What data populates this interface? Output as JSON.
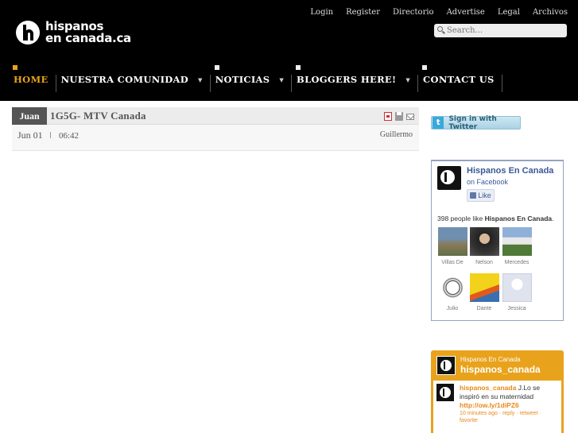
{
  "site": {
    "logo_line1": "hispanos",
    "logo_line2": "en canada.ca"
  },
  "top_links": [
    "Login",
    "Register",
    "Directorio",
    "Advertise",
    "Legal",
    "Archivos"
  ],
  "search": {
    "placeholder": "Search..."
  },
  "nav": [
    {
      "label": "HOME",
      "active": true,
      "dropdown": false
    },
    {
      "label": "NUESTRA COMUNIDAD",
      "active": false,
      "dropdown": true
    },
    {
      "label": "NOTICIAS",
      "active": false,
      "dropdown": true
    },
    {
      "label": "BLOGGERS HERE!",
      "active": false,
      "dropdown": true
    },
    {
      "label": "CONTACT US",
      "active": false,
      "dropdown": false
    }
  ],
  "article": {
    "month_tab": "Juan",
    "title": "1G5G- MTV Canada",
    "date": "Jun 01",
    "time": "06:42",
    "author": "Guillermo"
  },
  "twitter_button": {
    "label": "Sign in with Twitter"
  },
  "facebook": {
    "page_name": "Hispanos En Canada",
    "subtitle": "on Facebook",
    "like_label": "Like",
    "count_text": "398 people like",
    "count_page": "Hispanos En Canada",
    "fans": [
      "Villas De",
      "Nelson",
      "Mercedes",
      "Julio",
      "Dante",
      "Jessica"
    ]
  },
  "twitter_feed": {
    "name": "Hispanos En Canada",
    "handle": "hispanos_canada",
    "tweet_user": "hispanos_canada",
    "tweet_text": "J.Lo se inspiró en su maternidad",
    "tweet_link": "http://ow.ly/1diPZ6",
    "tweet_meta": "10 minutes ago · reply · retweet · favorite"
  },
  "colors": {
    "accent": "#e8a21c",
    "facebook_blue": "#3b5998",
    "header_bg": "#000000"
  }
}
